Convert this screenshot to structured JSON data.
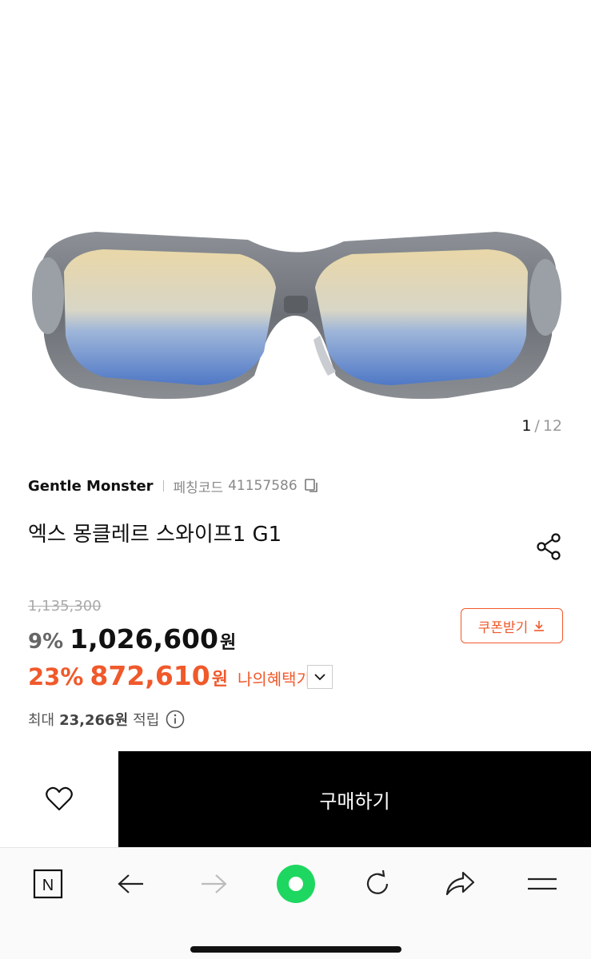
{
  "gallery": {
    "current": "1",
    "separator": "/",
    "total": "12"
  },
  "product": {
    "brand": "Gentle Monster",
    "code_label": "페칭코드",
    "code_value": "41157586",
    "name": "엑스 몽클레르 스와이프1 G1"
  },
  "pricing": {
    "original_price": "1,135,300",
    "sale_rate": "9%",
    "sale_price": "1,026,600",
    "sale_unit": "원",
    "coupon_label": "쿠폰받기",
    "benefit_rate": "23%",
    "benefit_price": "872,610",
    "benefit_unit": "원",
    "benefit_label": "나의혜택가",
    "points_prefix": "최대",
    "points_value": "23,266원",
    "points_suffix": "적립"
  },
  "actions": {
    "buy_label": "구매하기"
  },
  "browser": {
    "home_letter": "N",
    "accent": "#1ed760"
  },
  "colors": {
    "accent_orange": "#f0592b",
    "buy_button": "#000000"
  },
  "icons": [
    "copy-icon",
    "share-icon",
    "download-icon",
    "chevron-down-icon",
    "info-icon",
    "heart-icon",
    "naver-home-icon",
    "back-arrow-icon",
    "forward-arrow-icon",
    "green-dot-icon",
    "refresh-icon",
    "share-arrow-icon",
    "menu-icon"
  ]
}
